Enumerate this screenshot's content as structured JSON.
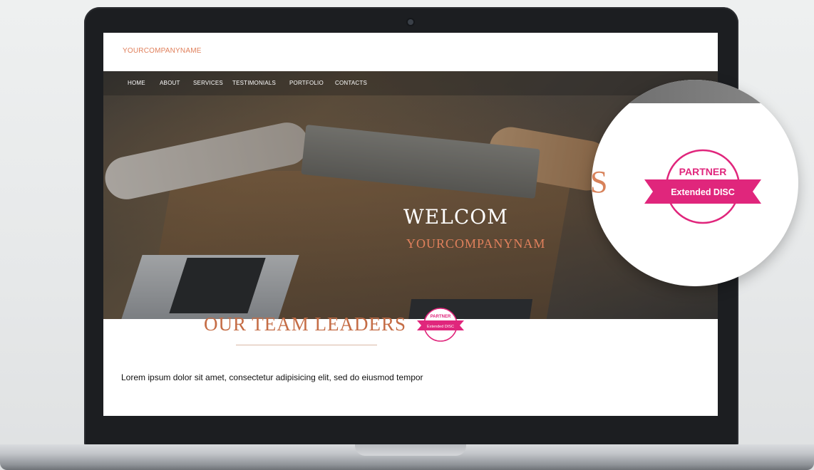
{
  "header": {
    "brand": "YOURCOMPANYNAME"
  },
  "nav": {
    "items": [
      {
        "label": "HOME"
      },
      {
        "label": "ABOUT"
      },
      {
        "label": "SERVICES"
      },
      {
        "label": "TESTIMONIALS"
      },
      {
        "label": "PORTFOLIO"
      },
      {
        "label": "CONTACTS"
      }
    ]
  },
  "hero": {
    "letter": "S",
    "welcome": "WELCOM",
    "company": "YOURCOMPANYNAM"
  },
  "section": {
    "title": "OUR TEAM LEADERS",
    "body": "Lorem ipsum dolor sit amet, consectetur adipisicing elit, sed do eiusmod tempor"
  },
  "badge": {
    "top_text": "PARTNER",
    "ribbon_text": "Extended DISC",
    "color": "#e0267c"
  }
}
